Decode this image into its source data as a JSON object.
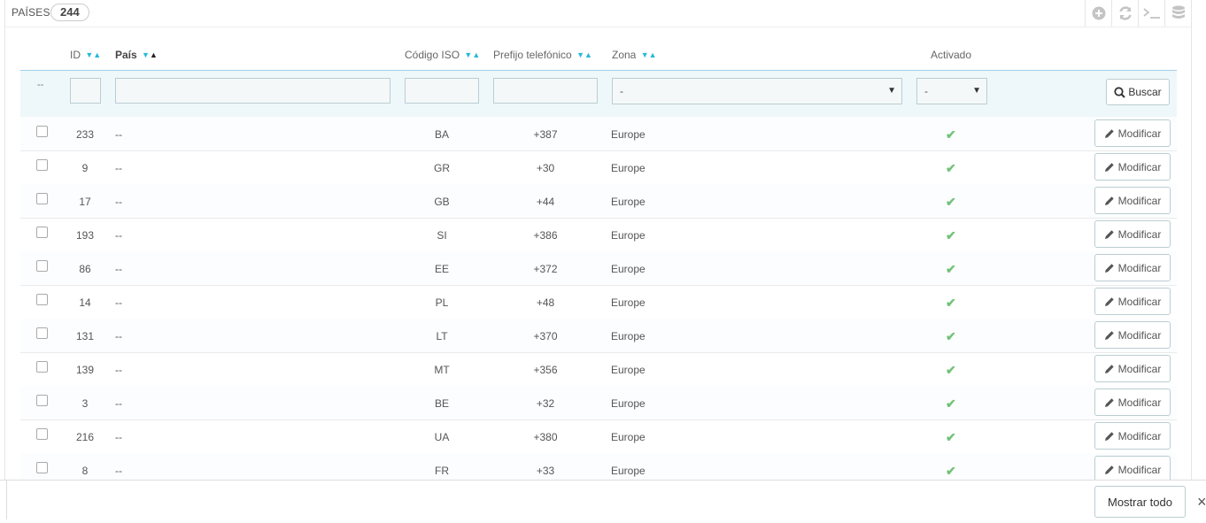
{
  "panel": {
    "title": "Países",
    "count": "244"
  },
  "toolbar": {
    "icons": [
      "add-new-icon",
      "refresh-icon",
      "sql-query-icon",
      "export-database-icon"
    ]
  },
  "columns": {
    "select": "--",
    "id": "ID",
    "country": "País",
    "iso": "Código ISO",
    "prefix": "Prefijo telefónico",
    "zone": "Zona",
    "active": "Activado"
  },
  "filters": {
    "zone_selected": "-",
    "active_selected": "-",
    "search_label": "Buscar"
  },
  "rows": [
    {
      "id": "233",
      "country": "--",
      "iso": "BA",
      "prefix": "+387",
      "zone": "Europe"
    },
    {
      "id": "9",
      "country": "--",
      "iso": "GR",
      "prefix": "+30",
      "zone": "Europe"
    },
    {
      "id": "17",
      "country": "--",
      "iso": "GB",
      "prefix": "+44",
      "zone": "Europe"
    },
    {
      "id": "193",
      "country": "--",
      "iso": "SI",
      "prefix": "+386",
      "zone": "Europe"
    },
    {
      "id": "86",
      "country": "--",
      "iso": "EE",
      "prefix": "+372",
      "zone": "Europe"
    },
    {
      "id": "14",
      "country": "--",
      "iso": "PL",
      "prefix": "+48",
      "zone": "Europe"
    },
    {
      "id": "131",
      "country": "--",
      "iso": "LT",
      "prefix": "+370",
      "zone": "Europe"
    },
    {
      "id": "139",
      "country": "--",
      "iso": "MT",
      "prefix": "+356",
      "zone": "Europe"
    },
    {
      "id": "3",
      "country": "--",
      "iso": "BE",
      "prefix": "+32",
      "zone": "Europe"
    },
    {
      "id": "216",
      "country": "--",
      "iso": "UA",
      "prefix": "+380",
      "zone": "Europe"
    },
    {
      "id": "8",
      "country": "--",
      "iso": "FR",
      "prefix": "+33",
      "zone": "Europe"
    }
  ],
  "row_action_label": "Modificar",
  "footer": {
    "show_all_label": "Mostrar todo",
    "close_glyph": "×"
  },
  "colors": {
    "accent": "#25b9d7",
    "check": "#72c279",
    "filter_bg": "#eef7fa"
  }
}
